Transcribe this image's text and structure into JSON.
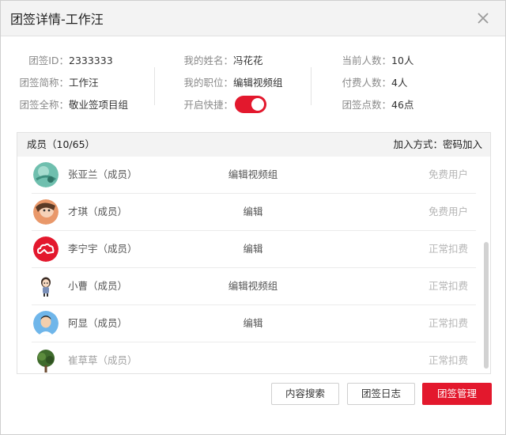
{
  "window": {
    "title": "团签详情-工作汪"
  },
  "info": {
    "col1": [
      {
        "label": "团签ID：",
        "value": "2333333"
      },
      {
        "label": "团签简称：",
        "value": "工作汪"
      },
      {
        "label": "团签全称：",
        "value": "敬业签项目组"
      }
    ],
    "col2": [
      {
        "label": "我的姓名：",
        "value": "冯花花"
      },
      {
        "label": "我的职位：",
        "value": "编辑视频组"
      },
      {
        "label": "开启快捷：",
        "toggle": true
      }
    ],
    "col3": [
      {
        "label": "当前人数：",
        "value": "10人"
      },
      {
        "label": "付费人数：",
        "value": "4人"
      },
      {
        "label": "团签点数：",
        "value": "46点"
      }
    ]
  },
  "members": {
    "header": "成员（10/65）",
    "join_method": "加入方式：密码加入",
    "rows": [
      {
        "name": "张亚兰（成员）",
        "role": "编辑视频组",
        "status": "免费用户",
        "avatar": "globe-avatar"
      },
      {
        "name": "才琪（成员）",
        "role": "编辑",
        "status": "免费用户",
        "avatar": "photo-avatar"
      },
      {
        "name": "李宁宇（成员）",
        "role": "编辑",
        "status": "正常扣费",
        "avatar": "cloud-logo-avatar"
      },
      {
        "name": "小曹（成员）",
        "role": "编辑视频组",
        "status": "正常扣费",
        "avatar": "cartoon-avatar"
      },
      {
        "name": "阿显（成员）",
        "role": "编辑",
        "status": "正常扣费",
        "avatar": "portrait-avatar"
      },
      {
        "name": "崔草草（成员）",
        "role": "",
        "status": "正常扣费",
        "avatar": "tree-avatar"
      }
    ]
  },
  "buttons": {
    "search": "内容搜索",
    "log": "团签日志",
    "manage": "团签管理"
  },
  "colors": {
    "accent": "#e3182d"
  }
}
